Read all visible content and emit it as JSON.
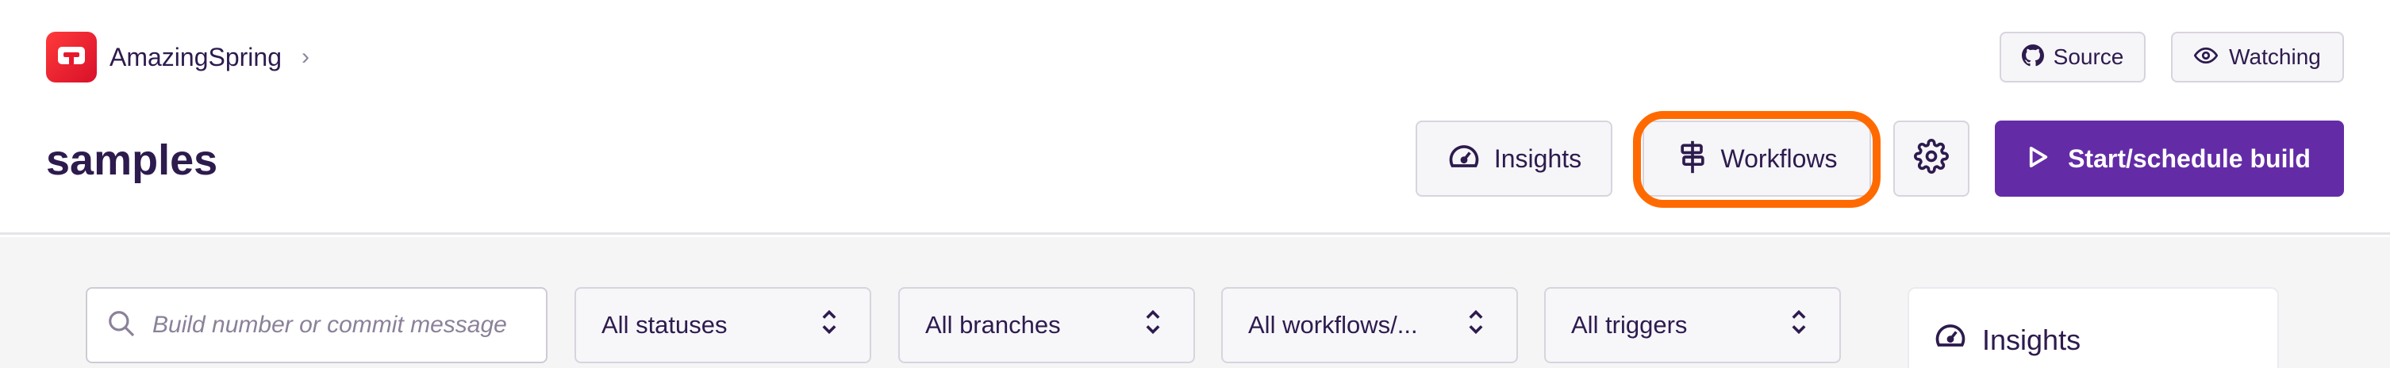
{
  "app": {
    "name": "AmazingSpring"
  },
  "page": {
    "title": "samples"
  },
  "topbar": {
    "source_label": "Source",
    "watching_label": "Watching"
  },
  "actions": {
    "insights_label": "Insights",
    "workflows_label": "Workflows",
    "start_label": "Start/schedule build"
  },
  "filters": {
    "search_placeholder": "Build number or commit message",
    "status": "All statuses",
    "branches": "All branches",
    "workflows": "All workflows/...",
    "triggers": "All triggers"
  },
  "panel": {
    "title": "Insights"
  },
  "icons": {
    "logo": "bitrise-logo",
    "breadcrumb": "chevron-right-icon",
    "source": "github-icon",
    "watching": "eye-icon",
    "insights": "speedometer-icon",
    "workflows": "workflow-icon",
    "settings": "gear-icon",
    "start": "play-icon",
    "search": "search-icon",
    "select": "updown-chevron-icon"
  },
  "colors": {
    "brand": "#632ca6",
    "highlight": "#ff6a00",
    "logo": "#e8182c",
    "text": "#2d1b4e"
  }
}
